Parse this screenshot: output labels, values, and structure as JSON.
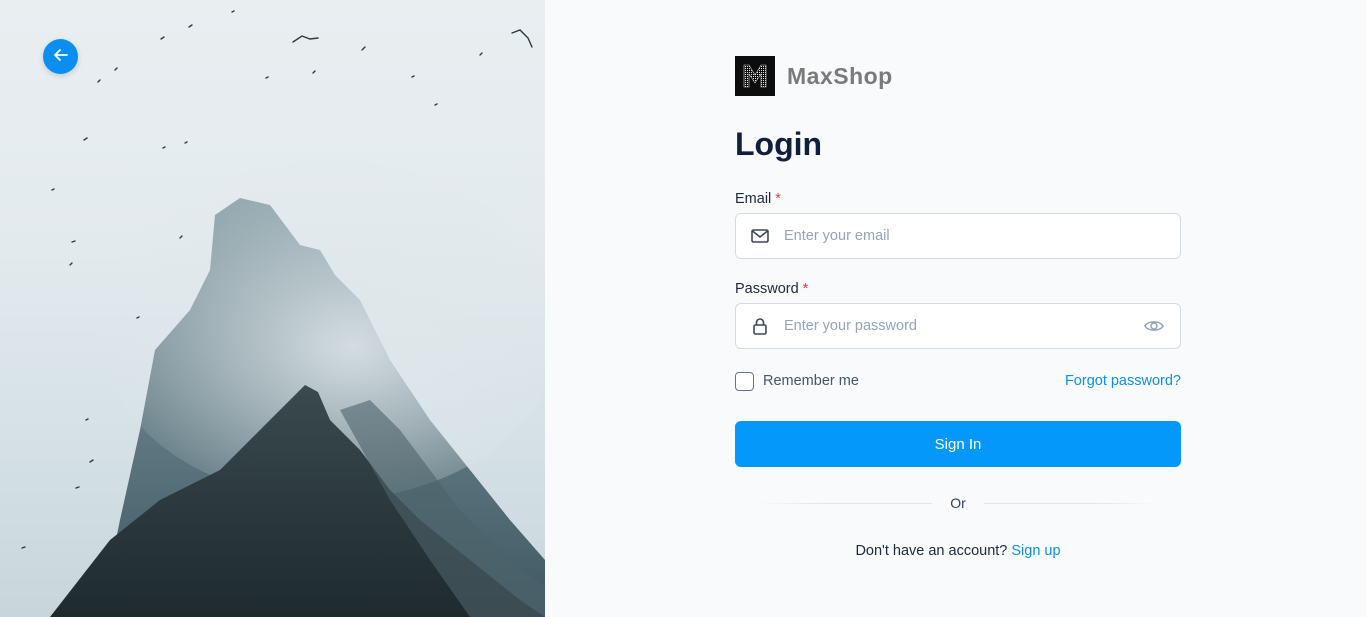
{
  "brand": {
    "name": "MaxShop",
    "logo_letter": "M"
  },
  "title": "Login",
  "email": {
    "label": "Email",
    "required_mark": "*",
    "placeholder": "Enter your email",
    "value": ""
  },
  "password": {
    "label": "Password",
    "required_mark": "*",
    "placeholder": "Enter your password",
    "value": ""
  },
  "remember": {
    "label": "Remember me",
    "checked": false
  },
  "forgot_label": "Forgot password?",
  "signin_label": "Sign In",
  "divider_label": "Or",
  "signup": {
    "prompt": "Don't have an account?",
    "link_label": "Sign up"
  },
  "icons": {
    "back": "arrow-left-icon",
    "email": "mail-icon",
    "password": "lock-icon",
    "toggle": "eye-icon"
  },
  "colors": {
    "accent": "#0598fb",
    "link": "#0a8ff0",
    "required": "#e53e3e",
    "title": "#0f1f3d"
  }
}
